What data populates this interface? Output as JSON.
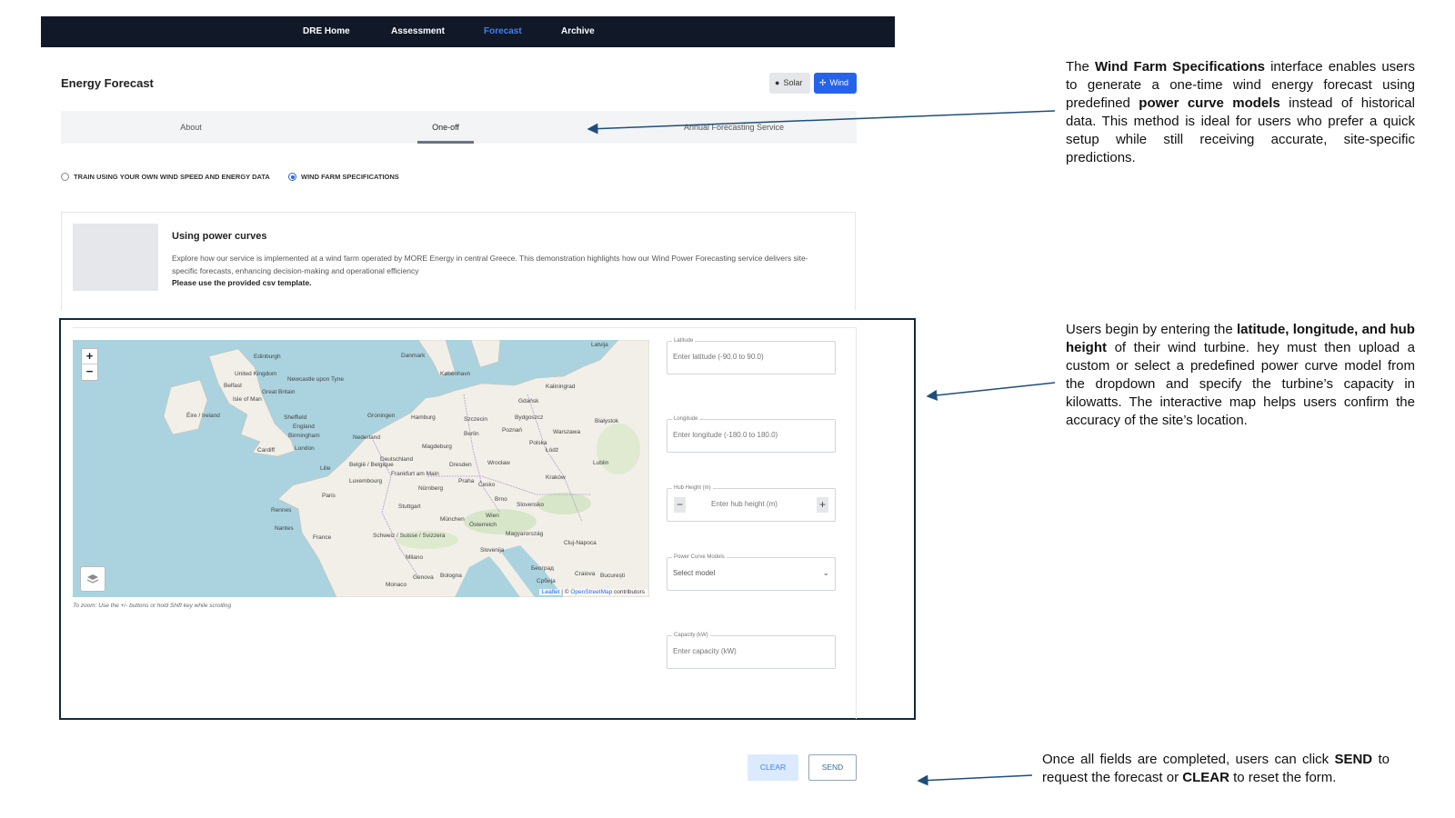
{
  "nav": {
    "items": [
      {
        "label": "DRE Home",
        "active": false
      },
      {
        "label": "Assessment",
        "active": false
      },
      {
        "label": "Forecast",
        "active": true
      },
      {
        "label": "Archive",
        "active": false
      }
    ]
  },
  "header": {
    "title": "Energy Forecast",
    "solar_label": "Solar",
    "wind_label": "Wind",
    "selected": "Wind"
  },
  "tabs": [
    {
      "label": "About",
      "active": false
    },
    {
      "label": "One-off",
      "active": true
    },
    {
      "label": "Annual Forecasting Service",
      "active": false
    }
  ],
  "mode": {
    "option_train": "TRAIN USING YOUR OWN WIND SPEED AND ENERGY DATA",
    "option_specs": "WIND FARM SPECIFICATIONS",
    "selected": "WIND FARM SPECIFICATIONS"
  },
  "info": {
    "title": "Using power curves",
    "description": "Explore how our service is implemented at a wind farm operated by MORE Energy in central Greece. This demonstration highlights how our Wind Power Forecasting service delivers site-specific forecasts, enhancing decision-making and operational efficiency",
    "note": "Please use the provided csv template."
  },
  "map": {
    "zoom_in": "+",
    "zoom_out": "−",
    "attribution_leaflet": "Leaflet",
    "attribution_sep": " | © ",
    "attribution_osm": "OpenStreetMap",
    "attribution_suffix": " contributors",
    "hint": "To zoom: Use the +/- buttons or hold Shift key while scrolling",
    "labels": {
      "danmark": "Danmark",
      "latvija": "Latvija",
      "edinburgh": "Edinburgh",
      "united_kingdom": "United Kingdom",
      "newcastle": "Newcastle upon Tyne",
      "great_britain": "Great Britain",
      "belfast": "Belfast",
      "isle_of_man": "Isle of Man",
      "eire": "Éire / Ireland",
      "sheffield": "Sheffield",
      "birmingham": "Birmingham",
      "england": "England",
      "cardiff": "Cardiff",
      "london": "London",
      "kobenhavn": "København",
      "kaliningrad": "Kaliningrad",
      "gdansk": "Gdańsk",
      "bydgoszcz": "Bydgoszcz",
      "hamburg": "Hamburg",
      "groningen": "Groningen",
      "szczecin": "Szczecin",
      "nederland": "Nederland",
      "berlin": "Berlin",
      "poznan": "Poznań",
      "warszawa": "Warszawa",
      "bialystok": "Białystok",
      "magdeburg": "Magdeburg",
      "polska": "Polska",
      "deutschland": "Deutschland",
      "belgie": "België / Belgique",
      "lodz": "Łódź",
      "lublin": "Lublin",
      "wroclaw": "Wrocław",
      "dresden": "Dresden",
      "lille": "Lille",
      "frankfurt": "Frankfurt am Main",
      "praha": "Praha",
      "luxembourg": "Luxembourg",
      "nurnberg": "Nürnberg",
      "cesko": "Česko",
      "krakow": "Kraków",
      "rennes": "Rennes",
      "paris": "Paris",
      "stuttgart": "Stuttgart",
      "brno": "Brno",
      "slovensko": "Slovensko",
      "munchen": "München",
      "wien": "Wien",
      "osterreich": "Österreich",
      "nantes": "Nantes",
      "france": "France",
      "schweiz": "Schweiz / Suisse / Svizzera",
      "magyarorszag": "Magyarország",
      "cluj": "Cluj-Napoca",
      "milano": "Milano",
      "slovenija": "Slovenija",
      "genova": "Genova",
      "bologna": "Bologna",
      "beograd": "Београд",
      "craiova": "Craiova",
      "bucuresti": "București",
      "monaco": "Monaco",
      "srbija": "Србија"
    }
  },
  "form": {
    "latitude": {
      "label": "Latitude",
      "placeholder": "Enter latitude (-90.0 to 90.0)"
    },
    "longitude": {
      "label": "Longitude",
      "placeholder": "Enter longitude (-180.0 to 180.0)"
    },
    "hub_height": {
      "label": "Hub Height (m)",
      "placeholder": "Enter hub height (m)",
      "minus": "−",
      "plus": "+"
    },
    "power_curve": {
      "label": "Power Curve Models",
      "selected": "Select model"
    },
    "capacity": {
      "label": "Capacity (kW)",
      "placeholder": "Enter capacity (kW)"
    }
  },
  "actions": {
    "clear_label": "CLEAR",
    "send_label": "SEND"
  },
  "annotations": {
    "top": {
      "p1": "The ",
      "b1": "Wind Farm Specifications",
      "p2": " interface enables users to generate a one-time wind energy forecast using predefined ",
      "b2": "power curve models",
      "p3": " instead of historical data. This method is ideal for users who prefer a quick setup while still receiving accurate, site-specific predictions."
    },
    "middle": {
      "p1": "Users begin by entering the ",
      "b1": "latitude, longitude, and hub height",
      "p2": " of their wind turbine. hey must then upload a custom or select a predefined power curve model from the dropdown and specify the turbine’s capacity in kilowatts. The interactive map helps users confirm the accuracy of the site’s location."
    },
    "bottom": {
      "p1": "Once all fields are completed, users can click ",
      "b1": "SEND",
      "p2": " to request the forecast or ",
      "b2": "CLEAR",
      "p3": " to reset the form."
    }
  },
  "colors": {
    "nav_bg": "#111827",
    "accent": "#2563eb",
    "frame": "#102a3a",
    "water": "#aad3df",
    "land": "#f2efe9"
  }
}
